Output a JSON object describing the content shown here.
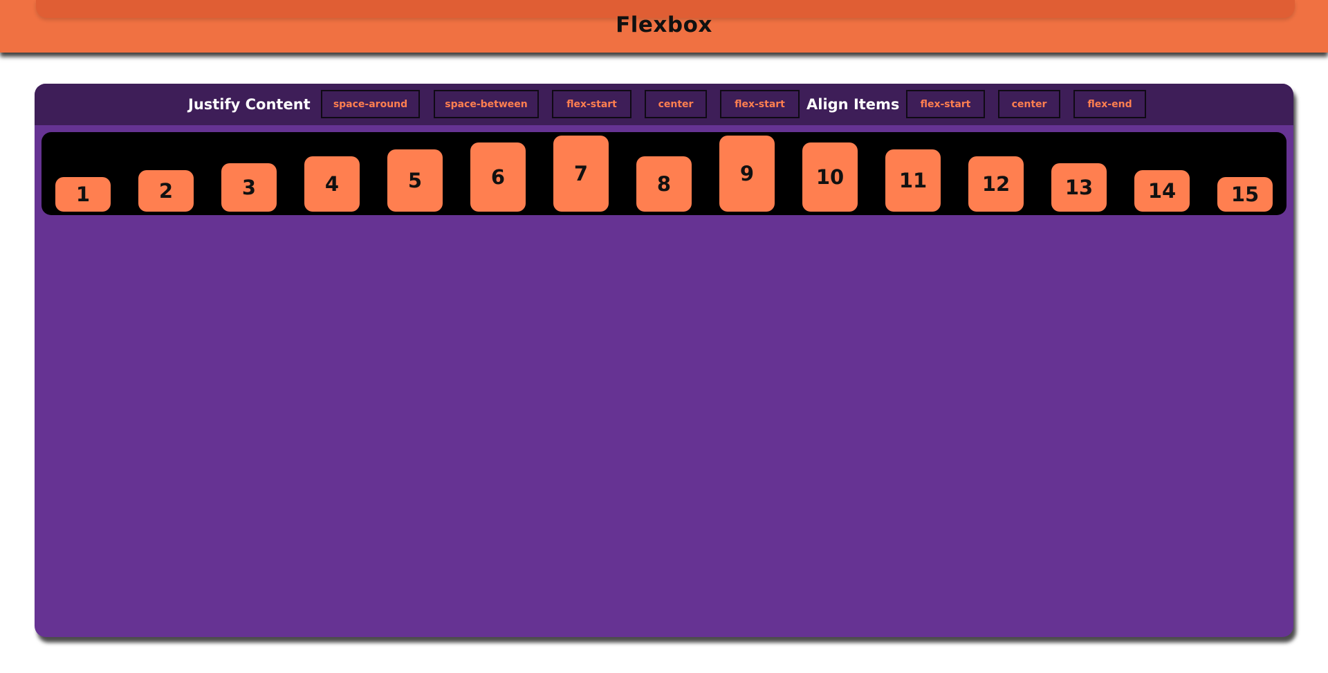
{
  "header": {
    "title": "Flexbox"
  },
  "controls": {
    "justify_label": "Justify Content",
    "justify_buttons": [
      "space-around",
      "space-between",
      "flex-start",
      "center",
      "flex-start"
    ],
    "align_label": "Align Items",
    "align_buttons": [
      "flex-start",
      "center",
      "flex-end"
    ]
  },
  "boxes": [
    "1",
    "2",
    "3",
    "4",
    "5",
    "6",
    "7",
    "8",
    "9",
    "10",
    "11",
    "12",
    "13",
    "14",
    "15"
  ],
  "colors": {
    "header": "#f07142",
    "header_band": "#e05e34",
    "panel": "#663393",
    "controls_bar": "#3e1e58",
    "container": "#000000",
    "box": "#ff7f50",
    "button_text": "#ff7f50"
  }
}
